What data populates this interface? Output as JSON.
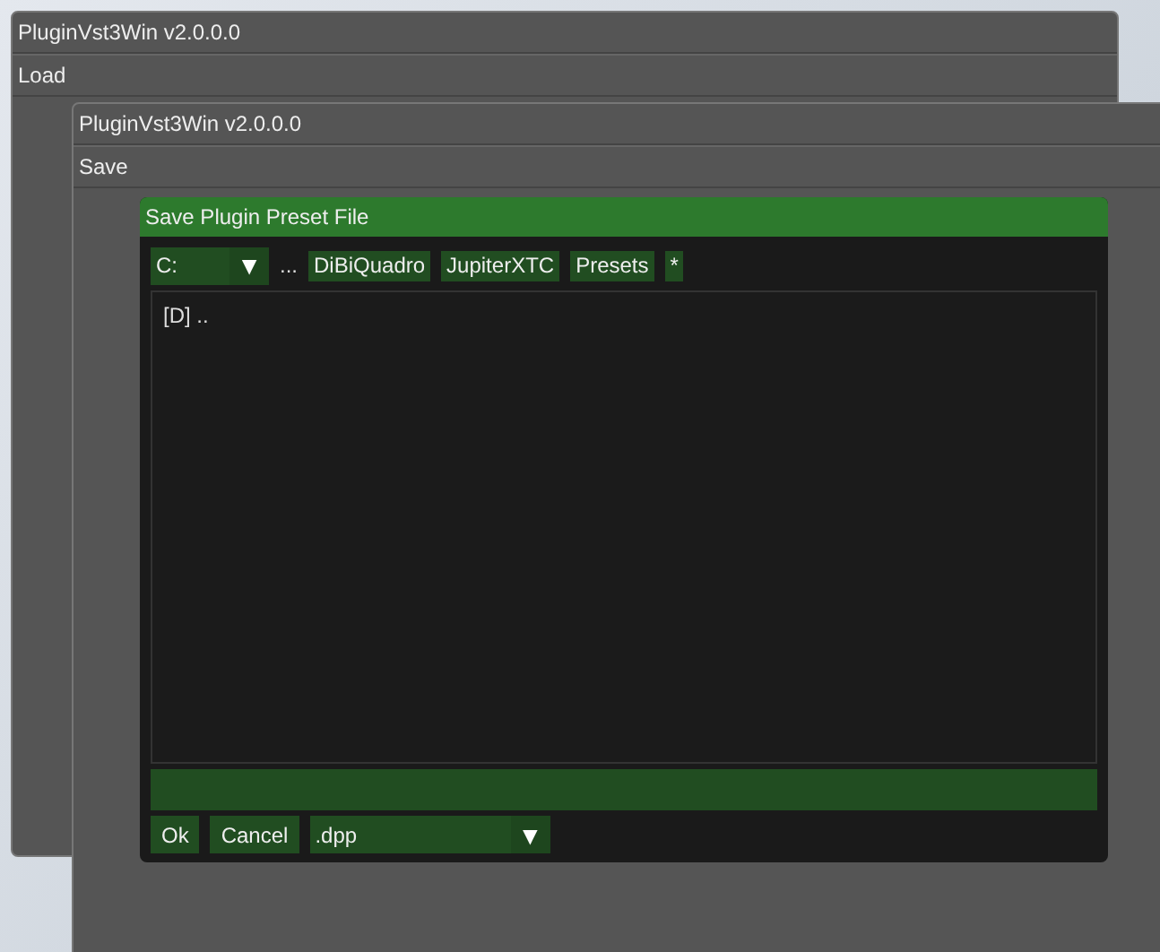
{
  "windows": [
    {
      "title": "PluginVst3Win v2.0.0.0",
      "header": "Load"
    },
    {
      "title": "PluginVst3Win v2.0.0.0",
      "header": "Save"
    }
  ],
  "dialog": {
    "title": "Save Plugin Preset File",
    "drive": {
      "value": "C:",
      "arrow": "▼"
    },
    "ellipsis": "...",
    "path": [
      "DiBiQuadro",
      "JupiterXTC",
      "Presets",
      "*"
    ],
    "entries": [
      "[D] .."
    ],
    "buttons": [
      "Ok",
      "Cancel"
    ],
    "filter": {
      "value": ".dpp",
      "arrow": "▼"
    }
  }
}
